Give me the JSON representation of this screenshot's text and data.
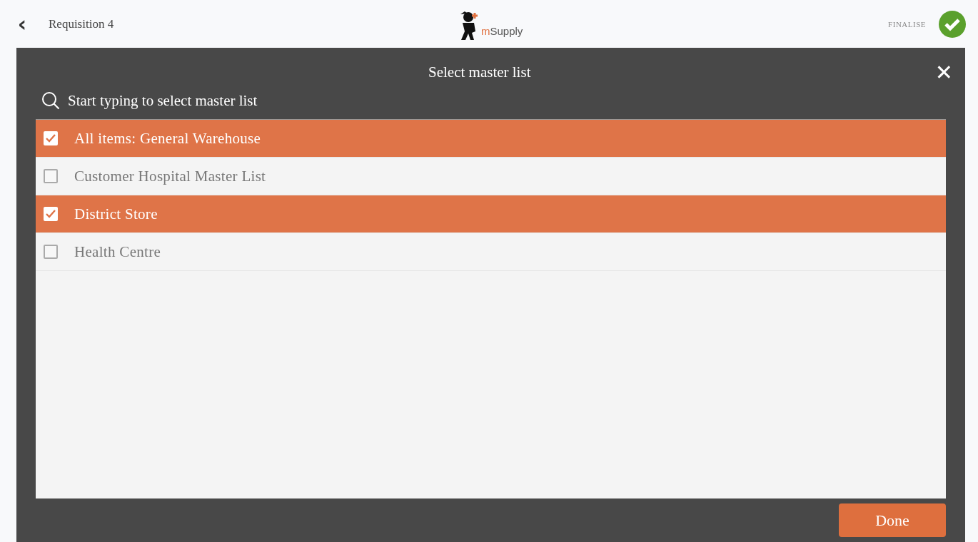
{
  "header": {
    "back_icon": "‹",
    "title": "Requisition 4",
    "logo_text": "mSupply",
    "finalise_label": "FINALISE",
    "finalised": true
  },
  "modal": {
    "title": "Select master list",
    "close": "✕",
    "search": {
      "placeholder": "Start typing to select master list"
    },
    "items": [
      {
        "label": "All items: General Warehouse",
        "selected": true
      },
      {
        "label": "Customer Hospital Master List",
        "selected": false
      },
      {
        "label": "District Store",
        "selected": true
      },
      {
        "label": "Health Centre",
        "selected": false
      }
    ],
    "done_button": "Done"
  }
}
